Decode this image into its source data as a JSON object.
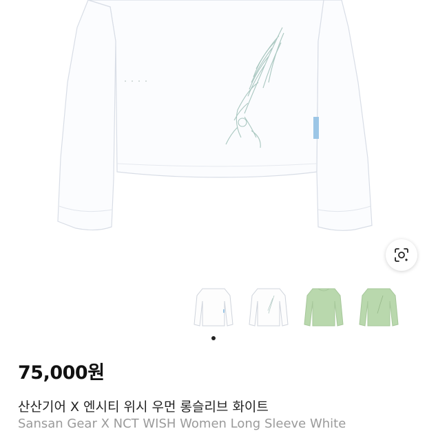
{
  "product": {
    "price": "75,000원",
    "title_ko": "산산기어 X 엔시티 위시 우먼 롱슬리브 화이트",
    "title_en": "Sansan Gear X NCT WISH Women Long Sleeve White"
  },
  "gallery": {
    "thumbnails": [
      {
        "color": "#ffffff",
        "icon": "white-tee-front"
      },
      {
        "color": "#ffffff",
        "icon": "white-tee-back"
      },
      {
        "color": "#b9d8ad",
        "icon": "green-tee-front"
      },
      {
        "color": "#b9d8ad",
        "icon": "green-tee-back"
      }
    ],
    "current_index": 1
  },
  "colors": {
    "shirt": "#fbfcfe",
    "outline": "#d8dde6",
    "print": "#a9c7c0",
    "green": "#b9d8ad",
    "tag": "#9cc6e6"
  }
}
